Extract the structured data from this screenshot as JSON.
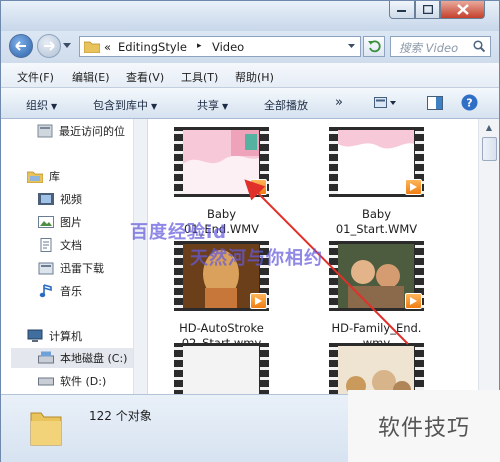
{
  "address": {
    "prefix": "«",
    "crumb1": "EditingStyle",
    "sep": "▸",
    "crumb2": "Video"
  },
  "search": {
    "placeholder": "搜索 Video"
  },
  "menu": [
    "文件(F)",
    "编辑(E)",
    "查看(V)",
    "工具(T)",
    "帮助(H)"
  ],
  "toolbar": {
    "organize": "组织",
    "include": "包含到库中",
    "share": "共享",
    "playall": "全部播放",
    "more": "»"
  },
  "nav": {
    "recent": "最近访问的位",
    "libraries": "库",
    "videos": "视频",
    "pictures": "图片",
    "documents": "文档",
    "thunder": "迅雷下载",
    "music": "音乐",
    "computer": "计算机",
    "local_c": "本地磁盘 (C:)",
    "soft_d": "软件 (D:)"
  },
  "files": [
    {
      "name_line1": "Baby",
      "name_line2": "01_End.WMV"
    },
    {
      "name_line1": "Baby",
      "name_line2": "01_Start.WMV"
    },
    {
      "name_line1": "HD-AutoStroke",
      "name_line2": "02_Start.wmv"
    },
    {
      "name_line1": "HD-Family_End.",
      "name_line2": "wmv"
    },
    {
      "name_line1": "",
      "name_line2": ""
    },
    {
      "name_line1": "",
      "name_line2": ""
    }
  ],
  "status": {
    "count": "122 个对象"
  },
  "watermark": {
    "line1": "百度经验id",
    "line2": "天然河与你相约"
  },
  "brand": "软件技巧",
  "colors": {
    "arrow": "#e0302a",
    "watermark": "#6a5ae0",
    "badge": "#ef7d12"
  }
}
